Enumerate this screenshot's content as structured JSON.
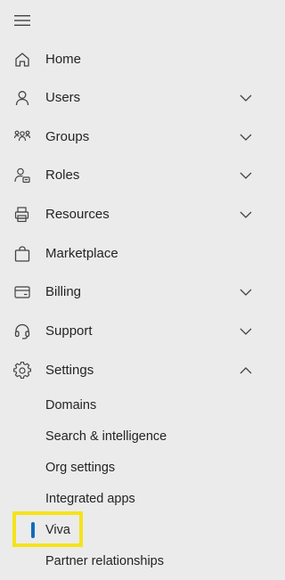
{
  "menu": {
    "icon": "hamburger-menu-icon"
  },
  "nav_items": [
    {
      "label": "Home",
      "icon": "home-icon",
      "chevron": "none"
    },
    {
      "label": "Users",
      "icon": "person-icon",
      "chevron": "down"
    },
    {
      "label": "Groups",
      "icon": "people-team-icon",
      "chevron": "down"
    },
    {
      "label": "Roles",
      "icon": "person-badge-icon",
      "chevron": "down"
    },
    {
      "label": "Resources",
      "icon": "printer-icon",
      "chevron": "down"
    },
    {
      "label": "Marketplace",
      "icon": "shopping-bag-icon",
      "chevron": "none"
    },
    {
      "label": "Billing",
      "icon": "credit-card-icon",
      "chevron": "down"
    },
    {
      "label": "Support",
      "icon": "headset-icon",
      "chevron": "down"
    },
    {
      "label": "Settings",
      "icon": "gear-icon",
      "chevron": "up"
    }
  ],
  "settings_subitems": [
    {
      "label": "Domains",
      "selected": false
    },
    {
      "label": "Search & intelligence",
      "selected": false
    },
    {
      "label": "Org settings",
      "selected": false
    },
    {
      "label": "Integrated apps",
      "selected": false
    },
    {
      "label": "Viva",
      "selected": true
    },
    {
      "label": "Partner relationships",
      "selected": false
    }
  ],
  "colors": {
    "background": "#ebebeb",
    "text": "#242424",
    "selected_indicator": "#0f6cbd",
    "highlight_box": "#f5e31a"
  }
}
